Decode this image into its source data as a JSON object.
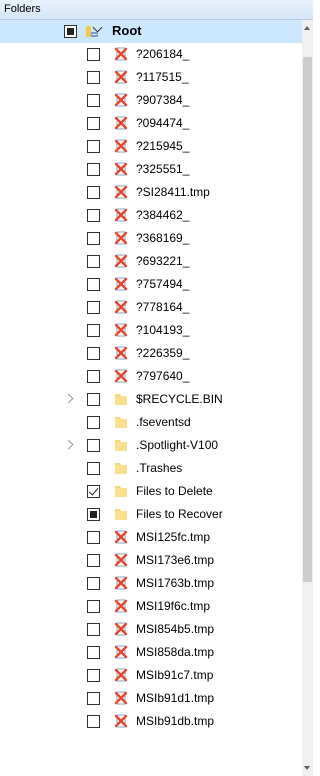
{
  "panel": {
    "title": "Folders"
  },
  "root": {
    "label": "Root",
    "check_state": "partial",
    "expanded": true
  },
  "items": [
    {
      "label": "?206184_",
      "icon": "deleted-file-icon",
      "check": "none",
      "expander": "none"
    },
    {
      "label": "?117515_",
      "icon": "deleted-file-icon",
      "check": "none",
      "expander": "none"
    },
    {
      "label": "?907384_",
      "icon": "deleted-file-icon",
      "check": "none",
      "expander": "none"
    },
    {
      "label": "?094474_",
      "icon": "deleted-file-icon",
      "check": "none",
      "expander": "none"
    },
    {
      "label": "?215945_",
      "icon": "deleted-file-icon",
      "check": "none",
      "expander": "none"
    },
    {
      "label": "?325551_",
      "icon": "deleted-file-icon",
      "check": "none",
      "expander": "none"
    },
    {
      "label": "?SI28411.tmp",
      "icon": "deleted-file-icon",
      "check": "none",
      "expander": "none"
    },
    {
      "label": "?384462_",
      "icon": "deleted-file-icon",
      "check": "none",
      "expander": "none"
    },
    {
      "label": "?368169_",
      "icon": "deleted-file-icon",
      "check": "none",
      "expander": "none"
    },
    {
      "label": "?693221_",
      "icon": "deleted-file-icon",
      "check": "none",
      "expander": "none"
    },
    {
      "label": "?757494_",
      "icon": "deleted-file-icon",
      "check": "none",
      "expander": "none"
    },
    {
      "label": "?778164_",
      "icon": "deleted-file-icon",
      "check": "none",
      "expander": "none"
    },
    {
      "label": "?104193_",
      "icon": "deleted-file-icon",
      "check": "none",
      "expander": "none"
    },
    {
      "label": "?226359_",
      "icon": "deleted-file-icon",
      "check": "none",
      "expander": "none"
    },
    {
      "label": "?797640_",
      "icon": "deleted-file-icon",
      "check": "none",
      "expander": "none"
    },
    {
      "label": "$RECYCLE.BIN",
      "icon": "folder-icon",
      "check": "none",
      "expander": "collapsed"
    },
    {
      "label": ".fseventsd",
      "icon": "folder-icon",
      "check": "none",
      "expander": "none"
    },
    {
      "label": ".Spotlight-V100",
      "icon": "folder-icon",
      "check": "none",
      "expander": "collapsed"
    },
    {
      "label": ".Trashes",
      "icon": "folder-icon",
      "check": "none",
      "expander": "none"
    },
    {
      "label": "Files to Delete",
      "icon": "folder-icon",
      "check": "checked",
      "expander": "none"
    },
    {
      "label": "Files to Recover",
      "icon": "folder-icon",
      "check": "partial",
      "expander": "none"
    },
    {
      "label": "MSI125fc.tmp",
      "icon": "deleted-file-icon",
      "check": "none",
      "expander": "none"
    },
    {
      "label": "MSI173e6.tmp",
      "icon": "deleted-file-icon",
      "check": "none",
      "expander": "none"
    },
    {
      "label": "MSI1763b.tmp",
      "icon": "deleted-file-icon",
      "check": "none",
      "expander": "none"
    },
    {
      "label": "MSI19f6c.tmp",
      "icon": "deleted-file-icon",
      "check": "none",
      "expander": "none"
    },
    {
      "label": "MSI854b5.tmp",
      "icon": "deleted-file-icon",
      "check": "none",
      "expander": "none"
    },
    {
      "label": "MSI858da.tmp",
      "icon": "deleted-file-icon",
      "check": "none",
      "expander": "none"
    },
    {
      "label": "MSIb91c7.tmp",
      "icon": "deleted-file-icon",
      "check": "none",
      "expander": "none"
    },
    {
      "label": "MSIb91d1.tmp",
      "icon": "deleted-file-icon",
      "check": "none",
      "expander": "none"
    },
    {
      "label": "MSIb91db.tmp",
      "icon": "deleted-file-icon",
      "check": "none",
      "expander": "none"
    }
  ],
  "colors": {
    "selection": "#cce8ff",
    "folder": "#f8d775",
    "deleted_mark": "#e8452c",
    "header": "#d6e6f6"
  }
}
